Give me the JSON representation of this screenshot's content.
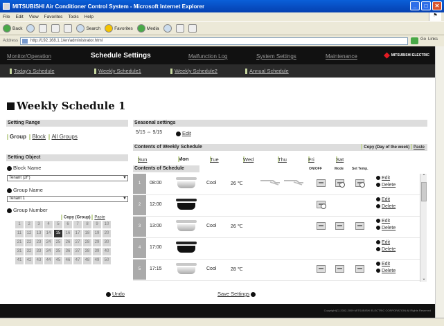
{
  "window": {
    "title": "MITSUBISHI Air Conditioner Control System - Microsoft Internet Explorer",
    "minimize": "_",
    "maximize": "□",
    "close": "✕"
  },
  "menu": [
    "File",
    "Edit",
    "View",
    "Favorites",
    "Tools",
    "Help"
  ],
  "toolbar": {
    "back": "Back",
    "search": "Search",
    "favorites": "Favorites",
    "media": "Media"
  },
  "address": {
    "label": "Address",
    "url": "http://192.168.1.1/en/administrator.html",
    "go": "Go",
    "links": "Links"
  },
  "nav": {
    "main": [
      "Monitor/Operation",
      "Schedule Settings",
      "Malfunction Log",
      "System Settings",
      "Maintenance"
    ],
    "active_index": 1,
    "sub": [
      "Today's Schedule",
      "Weekly Schedule1",
      "Weekly Schedule2",
      "Annual Schedule"
    ],
    "brand": "MITSUBISHI ELECTRIC"
  },
  "page_title": "Weekly Schedule 1",
  "setting_range": {
    "header": "Setting Range",
    "options": [
      "Group",
      "Block",
      "All Groups"
    ],
    "selected": "Group"
  },
  "setting_object": {
    "header": "Setting Object",
    "block_name_label": "Block Name",
    "block_name_value": "Tenant (2F)",
    "group_name_label": "Group Name",
    "group_name_value": "Tenant 1",
    "group_number_label": "Group Number",
    "copy_group": "Copy (Group)",
    "paste": "Paste",
    "numbers": [
      "1",
      "2",
      "3",
      "4",
      "5",
      "6",
      "7",
      "8",
      "9",
      "10",
      "11",
      "12",
      "13",
      "14",
      "15",
      "16",
      "17",
      "18",
      "19",
      "20",
      "21",
      "22",
      "23",
      "24",
      "25",
      "26",
      "27",
      "28",
      "29",
      "30",
      "31",
      "32",
      "33",
      "34",
      "35",
      "36",
      "37",
      "38",
      "39",
      "40",
      "41",
      "42",
      "43",
      "44",
      "45",
      "46",
      "47",
      "48",
      "49",
      "50"
    ],
    "selected_number": "15"
  },
  "seasonal": {
    "header": "Seasonal settings",
    "range": "5/15 ⇔ 9/15",
    "edit": "Edit"
  },
  "weekly": {
    "header": "Contents of Weekly Schedule",
    "copy_day": "Copy (Day of the week)",
    "paste": "Paste",
    "days": [
      "Sun",
      "Mon",
      "Tue",
      "Wed",
      "Thu",
      "Fri",
      "Sat"
    ],
    "selected_day": "Mon"
  },
  "schedule": {
    "header": "Contents of Schedule",
    "col_onoff": "ON/OFF",
    "col_mode": "Mode",
    "col_settemp": "Set Temp.",
    "edit": "Edit",
    "delete": "Delete",
    "rows": [
      {
        "idx": "1",
        "time": "08:00",
        "unit": "on",
        "mode": "Cool",
        "temp": "26 ℃"
      },
      {
        "idx": "2",
        "time": "12:00",
        "unit": "off",
        "mode": "",
        "temp": ""
      },
      {
        "idx": "3",
        "time": "13:00",
        "unit": "on",
        "mode": "Cool",
        "temp": "26 ℃"
      },
      {
        "idx": "4",
        "time": "17:00",
        "unit": "off",
        "mode": "",
        "temp": ""
      },
      {
        "idx": "5",
        "time": "17:15",
        "unit": "on",
        "mode": "Cool",
        "temp": "28 ℃"
      }
    ]
  },
  "bottom": {
    "undo": "Undo",
    "save": "Save Settings"
  },
  "footer": "Copyright(C) 2002-2009 MITSUBISHI ELECTRIC CORPORATION All Rights Reserved",
  "colors": {
    "nav_bg": "#111111",
    "accent_bar": "#c7d7a0",
    "section_header": "#dddddd",
    "title_bar": "#0a5fd8"
  }
}
